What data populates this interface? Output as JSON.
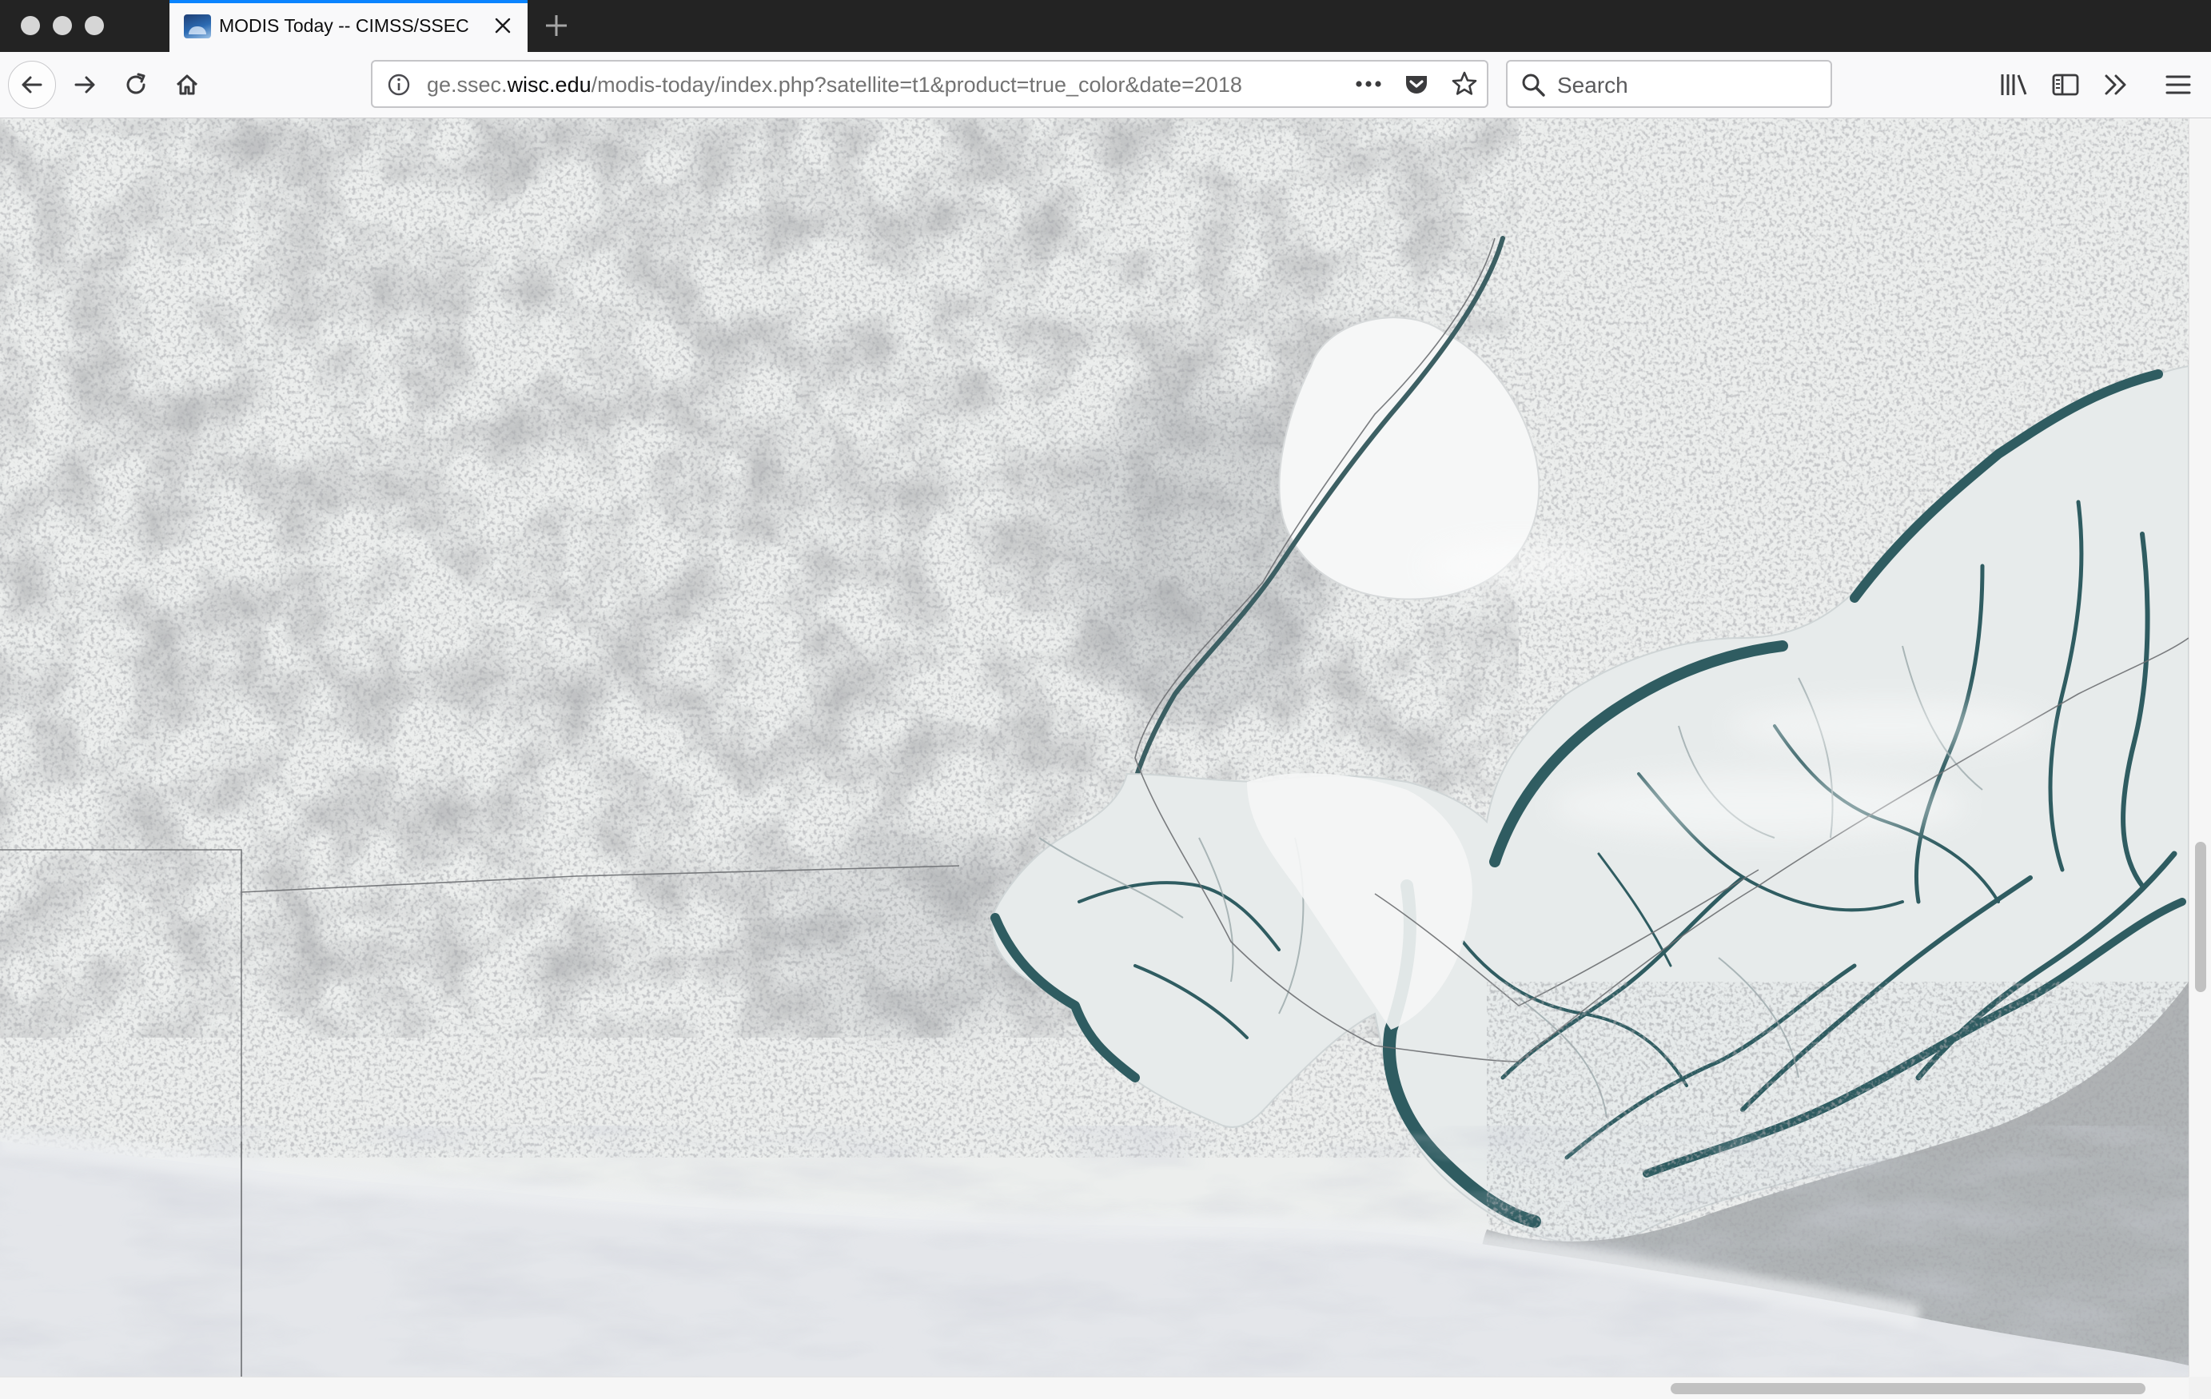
{
  "browser": {
    "tab": {
      "title": "MODIS Today -- CIMSS/SSEC",
      "favicon": "ssec-globe-icon"
    },
    "url": {
      "prefix": "ge.ssec.",
      "domain": "wisc.edu",
      "path": "/modis-today/index.php?satellite=t1&product=true_color&date=2018"
    },
    "search": {
      "placeholder": "Search"
    }
  },
  "colors": {
    "tab_accent": "#0a84ff",
    "titlebar": "#232323",
    "snow": "#eceeed",
    "water": "#2f5c61",
    "cloud": "#e4e6ea"
  },
  "imagery": {
    "satellite": "t1",
    "product": "true_color",
    "date_visible": "2018"
  }
}
